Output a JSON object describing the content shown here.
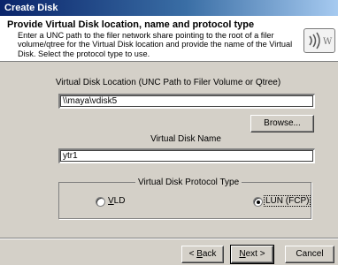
{
  "window": {
    "title": "Create Disk"
  },
  "header": {
    "title": "Provide Virtual Disk location, name and protocol type",
    "description": "Enter a UNC path to the filer network share pointing to the root of a filer volume/qtree for the Virtual Disk location and provide the name of the Virtual Disk. Select the protocol type to use.",
    "logo_icon": "disk-logo-icon"
  },
  "location": {
    "label": "Virtual Disk Location (UNC Path to Filer Volume or Qtree)",
    "value": "\\\\maya\\vdisk5"
  },
  "browse_label": "Browse...",
  "name": {
    "label": "Virtual Disk Name",
    "value": "ytr1"
  },
  "protocol": {
    "group_label": "Virtual Disk Protocol Type",
    "vld": {
      "label_rest": "LD",
      "label_key": "V",
      "selected": false
    },
    "lun": {
      "label": "LUN (FCP)",
      "selected": true
    }
  },
  "buttons": {
    "back_key": "B",
    "back_rest": "ack",
    "back_prefix": "< ",
    "next_key": "N",
    "next_rest": "ext >",
    "cancel": "Cancel"
  }
}
